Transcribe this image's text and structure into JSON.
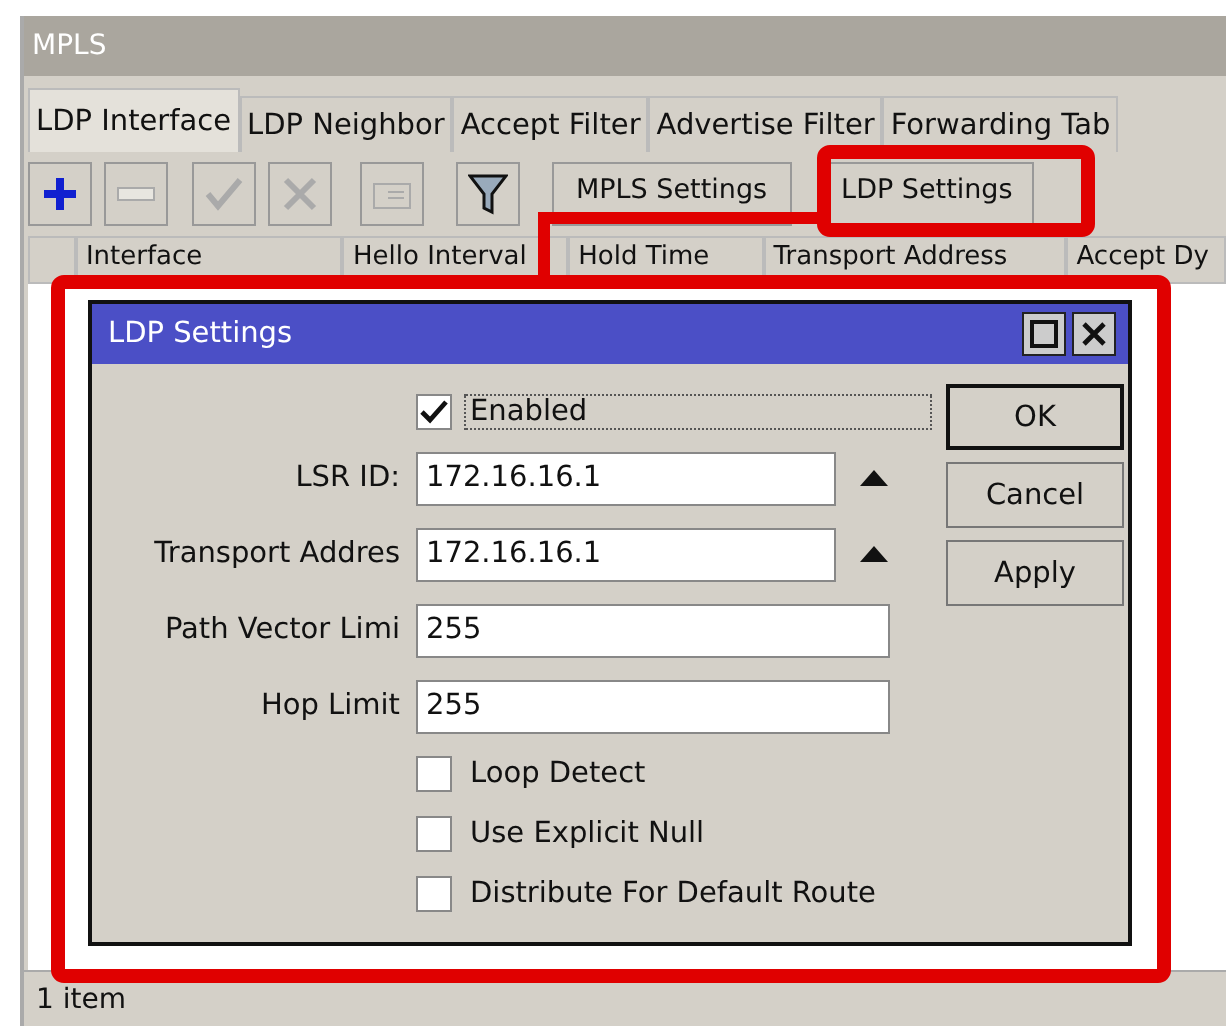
{
  "window": {
    "title": "MPLS"
  },
  "tabs": [
    {
      "label": "LDP Interface",
      "selected": true
    },
    {
      "label": "LDP Neighbor",
      "selected": false
    },
    {
      "label": "Accept Filter",
      "selected": false
    },
    {
      "label": "Advertise Filter",
      "selected": false
    },
    {
      "label": "Forwarding Tab",
      "selected": false
    }
  ],
  "toolbar": {
    "icons": [
      {
        "kind": "add",
        "disabled": false
      },
      {
        "kind": "remove",
        "disabled": true
      },
      {
        "kind": "enable",
        "disabled": true
      },
      {
        "kind": "disable",
        "disabled": true
      },
      {
        "kind": "comment",
        "disabled": true
      },
      {
        "kind": "filter",
        "disabled": false
      }
    ],
    "buttons": [
      "MPLS Settings",
      "LDP Settings"
    ]
  },
  "table": {
    "columns": [
      "Interface",
      "Hello Interval",
      "Hold Time",
      "Transport Address",
      "Accept Dy"
    ]
  },
  "dialog": {
    "title": "LDP Settings",
    "enabled": {
      "label": "Enabled",
      "checked": true
    },
    "fields": [
      {
        "label": "LSR ID:",
        "value": "172.16.16.1",
        "kind": "collapsible"
      },
      {
        "label": "Transport Addres",
        "value": "172.16.16.1",
        "kind": "collapsible"
      },
      {
        "label": "Path Vector Limi",
        "value": "255",
        "kind": "plain"
      },
      {
        "label": "Hop Limit",
        "value": "255",
        "kind": "plain"
      }
    ],
    "options": [
      {
        "label": "Loop Detect",
        "checked": false
      },
      {
        "label": "Use Explicit Null",
        "checked": false
      },
      {
        "label": "Distribute For Default Route",
        "checked": false
      }
    ],
    "buttons": [
      "OK",
      "Cancel",
      "Apply"
    ]
  },
  "status_bar": "1 item"
}
